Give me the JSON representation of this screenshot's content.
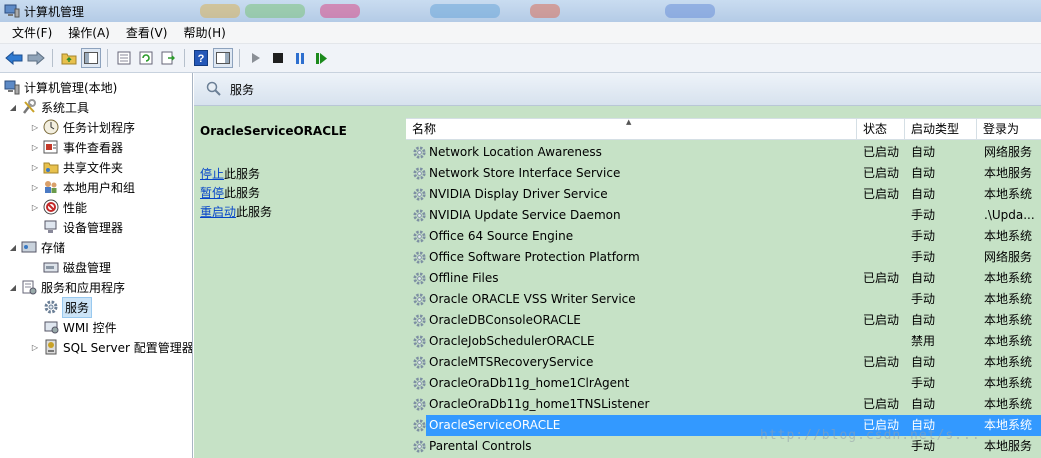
{
  "window": {
    "title": "计算机管理"
  },
  "menu": [
    "文件(F)",
    "操作(A)",
    "查看(V)",
    "帮助(H)"
  ],
  "toolbar": {
    "buttons": [
      "back-icon",
      "forward-icon",
      "up-folder-icon",
      "show-hide-console-tree-icon",
      "properties-icon",
      "refresh-icon",
      "export-list-icon",
      "help-icon",
      "action-pane-icon",
      "start-service-icon",
      "stop-service-icon",
      "pause-service-icon",
      "restart-service-icon"
    ]
  },
  "tree": {
    "root": "计算机管理(本地)",
    "system_tools": "系统工具",
    "task_scheduler": "任务计划程序",
    "event_viewer": "事件查看器",
    "shared_folders": "共享文件夹",
    "local_users": "本地用户和组",
    "performance": "性能",
    "device_manager": "设备管理器",
    "storage": "存储",
    "disk_management": "磁盘管理",
    "services_apps": "服务和应用程序",
    "services": "服务",
    "wmi": "WMI 控件",
    "sql_server": "SQL Server 配置管理器"
  },
  "header": {
    "title": "服务"
  },
  "detail": {
    "service_name": "OracleServiceORACLE",
    "stop_link": "停止",
    "stop_suffix": "此服务",
    "pause_link": "暂停",
    "pause_suffix": "此服务",
    "restart_link": "重启动",
    "restart_suffix": "此服务"
  },
  "columns": {
    "name": "名称",
    "status": "状态",
    "startup": "启动类型",
    "logon": "登录为"
  },
  "services": [
    {
      "name": "Network Location Awareness",
      "status": "已启动",
      "startup": "自动",
      "logon": "网络服务"
    },
    {
      "name": "Network Store Interface Service",
      "status": "已启动",
      "startup": "自动",
      "logon": "本地服务"
    },
    {
      "name": "NVIDIA Display Driver Service",
      "status": "已启动",
      "startup": "自动",
      "logon": "本地系统"
    },
    {
      "name": "NVIDIA Update Service Daemon",
      "status": "",
      "startup": "手动",
      "logon": ".\\Upda..."
    },
    {
      "name": "Office 64 Source Engine",
      "status": "",
      "startup": "手动",
      "logon": "本地系统"
    },
    {
      "name": "Office Software Protection Platform",
      "status": "",
      "startup": "手动",
      "logon": "网络服务"
    },
    {
      "name": "Offline Files",
      "status": "已启动",
      "startup": "自动",
      "logon": "本地系统"
    },
    {
      "name": "Oracle ORACLE VSS Writer Service",
      "status": "",
      "startup": "手动",
      "logon": "本地系统"
    },
    {
      "name": "OracleDBConsoleORACLE",
      "status": "已启动",
      "startup": "自动",
      "logon": "本地系统"
    },
    {
      "name": "OracleJobSchedulerORACLE",
      "status": "",
      "startup": "禁用",
      "logon": "本地系统"
    },
    {
      "name": "OracleMTSRecoveryService",
      "status": "已启动",
      "startup": "自动",
      "logon": "本地系统"
    },
    {
      "name": "OracleOraDb11g_home1ClrAgent",
      "status": "",
      "startup": "手动",
      "logon": "本地系统"
    },
    {
      "name": "OracleOraDb11g_home1TNSListener",
      "status": "已启动",
      "startup": "自动",
      "logon": "本地系统"
    },
    {
      "name": "OracleServiceORACLE",
      "status": "已启动",
      "startup": "自动",
      "logon": "本地系统",
      "selected": true
    },
    {
      "name": "Parental Controls",
      "status": "",
      "startup": "手动",
      "logon": "本地服务"
    }
  ],
  "watermark": "http://blog.csdn.net/s...",
  "colors": {
    "selection": "#3399ff",
    "panel_green": "#c6e2c6",
    "link": "#0645c9"
  }
}
